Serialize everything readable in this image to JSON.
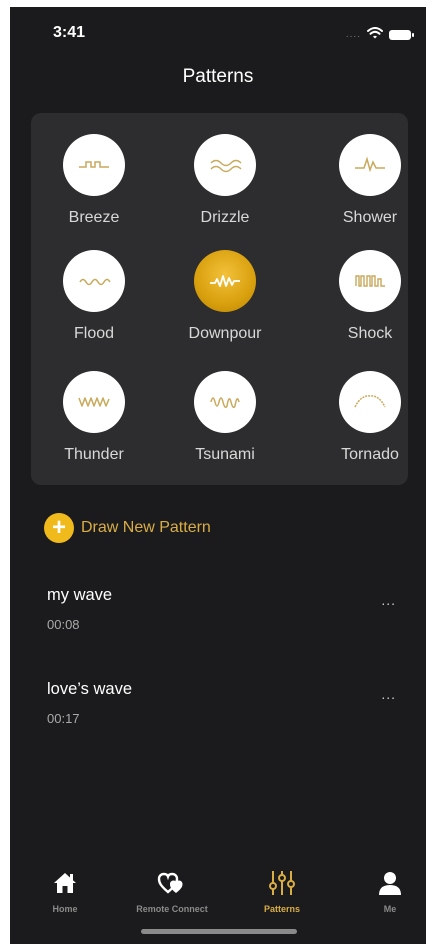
{
  "status_bar": {
    "time": "3:41",
    "signal": "....",
    "icons": [
      "wifi-icon",
      "battery-icon"
    ]
  },
  "header": {
    "title": "Patterns"
  },
  "patterns": [
    {
      "label": "Breeze",
      "icon": "breeze-wave-icon",
      "selected": false
    },
    {
      "label": "Drizzle",
      "icon": "drizzle-wave-icon",
      "selected": false
    },
    {
      "label": "Shower",
      "icon": "shower-wave-icon",
      "selected": false
    },
    {
      "label": "Flood",
      "icon": "flood-wave-icon",
      "selected": false
    },
    {
      "label": "Downpour",
      "icon": "downpour-wave-icon",
      "selected": true
    },
    {
      "label": "Shock",
      "icon": "shock-wave-icon",
      "selected": false
    },
    {
      "label": "Thunder",
      "icon": "thunder-wave-icon",
      "selected": false
    },
    {
      "label": "Tsunami",
      "icon": "tsunami-wave-icon",
      "selected": false
    },
    {
      "label": "Tornado",
      "icon": "tornado-wave-icon",
      "selected": false
    }
  ],
  "draw_new": {
    "label": "Draw New Pattern",
    "icon": "plus-icon"
  },
  "saved_waves": [
    {
      "name": "my wave",
      "duration": "00:08",
      "more": "..."
    },
    {
      "name": "love’s wave",
      "duration": "00:17",
      "more": "..."
    }
  ],
  "tab_bar": {
    "tabs": [
      {
        "label": "Home",
        "icon": "home-icon",
        "active": false
      },
      {
        "label": "Remote Connect",
        "icon": "hearts-icon",
        "active": false
      },
      {
        "label": "Patterns",
        "icon": "sliders-icon",
        "active": true
      },
      {
        "label": "Me",
        "icon": "person-icon",
        "active": false
      }
    ]
  },
  "colors": {
    "background": "#1b1b1d",
    "card": "#2d2d2f",
    "accent": "#d9ad44",
    "icon_stroke": "#c9a95c"
  }
}
